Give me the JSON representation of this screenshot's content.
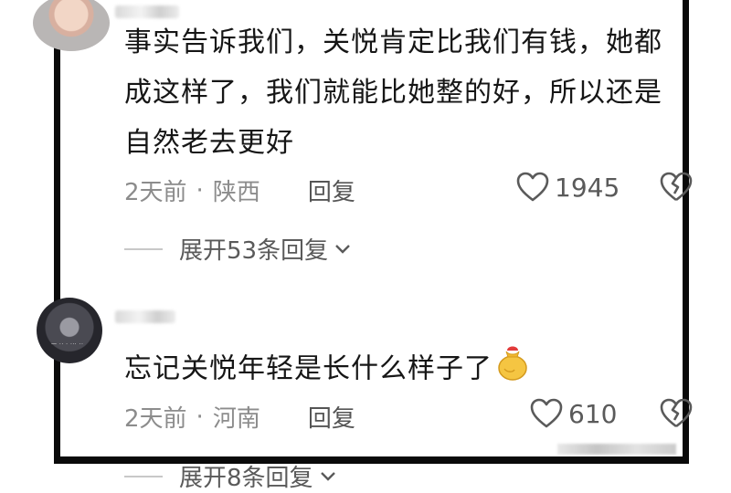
{
  "comments": [
    {
      "text": "事实告诉我们，关悦肯定比我们有钱，她都成这样了，我们就能比她整的好，所以还是自然老去更好",
      "time": "2天前",
      "location": "陕西",
      "reply_label": "回复",
      "likes": "1945",
      "expand_label": "展开53条回复"
    },
    {
      "text": "忘记关悦年轻是长什么样子了",
      "time": "2天前",
      "location": "河南",
      "reply_label": "回复",
      "likes": "610",
      "expand_label": "展开8条回复"
    }
  ],
  "icons": {
    "like": "heart-outline-icon",
    "dislike": "broken-heart-icon",
    "expand": "chevron-down-icon",
    "emoji": "money-bag-emoji-icon"
  },
  "colors": {
    "text": "#161616",
    "meta": "#8c8c8c",
    "frame": "#0a0a0a"
  }
}
